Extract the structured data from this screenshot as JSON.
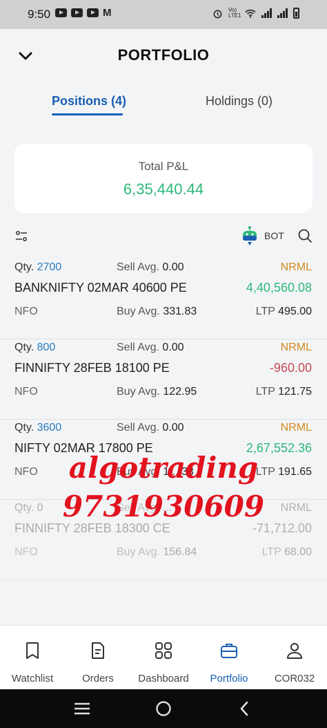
{
  "status_bar": {
    "time": "9:50",
    "network_label": "Vo) LTE1"
  },
  "header": {
    "title": "PORTFOLIO",
    "back_icon": "chevron-down-icon"
  },
  "tabs": [
    {
      "label": "Positions (4)",
      "active": true
    },
    {
      "label": "Holdings (0)",
      "active": false
    }
  ],
  "pnl": {
    "label": "Total P&L",
    "value": "6,35,440.44"
  },
  "toolbar": {
    "bot_label": "BOT"
  },
  "positions": [
    {
      "qty_label": "Qty.",
      "qty": "2700",
      "sell_label": "Sell Avg.",
      "sell_avg": "0.00",
      "product": "NRML",
      "symbol": "BANKNIFTY 02MAR 40600 PE",
      "pnl": "4,40,560.08",
      "pnl_sign": "positive",
      "exchange": "NFO",
      "buy_label": "Buy Avg.",
      "buy_avg": "331.83",
      "ltp_label": "LTP",
      "ltp": "495.00"
    },
    {
      "qty_label": "Qty.",
      "qty": "800",
      "sell_label": "Sell Avg.",
      "sell_avg": "0.00",
      "product": "NRML",
      "symbol": "FINNIFTY 28FEB 18100 PE",
      "pnl": "-960.00",
      "pnl_sign": "negative",
      "exchange": "NFO",
      "buy_label": "Buy Avg.",
      "buy_avg": "122.95",
      "ltp_label": "LTP",
      "ltp": "121.75"
    },
    {
      "qty_label": "Qty.",
      "qty": "3600",
      "sell_label": "Sell Avg.",
      "sell_avg": "0.00",
      "product": "NRML",
      "symbol": "NIFTY 02MAR 17800 PE",
      "pnl": "2,67,552.36",
      "pnl_sign": "positive",
      "exchange": "NFO",
      "buy_label": "Buy Avg.",
      "buy_avg": "1....33",
      "ltp_label": "LTP",
      "ltp": "191.65"
    },
    {
      "qty_label": "Qty.",
      "qty": "0",
      "sell_label": "Sell Avg.",
      "sell_avg": "...",
      "product": "NRML",
      "symbol": "FINNIFTY 28FEB 18300 CE",
      "pnl": "-71,712.00",
      "pnl_sign": "negative",
      "exchange": "NFO",
      "buy_label": "Buy Avg.",
      "buy_avg": "156.84",
      "ltp_label": "LTP",
      "ltp": "68.00"
    }
  ],
  "watermark": {
    "line1": "algotrading",
    "line2": "9731930609"
  },
  "bottom_nav": [
    {
      "label": "Watchlist",
      "icon": "bookmark-icon",
      "active": false
    },
    {
      "label": "Orders",
      "icon": "document-icon",
      "active": false
    },
    {
      "label": "Dashboard",
      "icon": "grid-icon",
      "active": false
    },
    {
      "label": "Portfolio",
      "icon": "briefcase-icon",
      "active": true
    },
    {
      "label": "COR032",
      "icon": "user-icon",
      "active": false
    }
  ],
  "colors": {
    "accent": "#1a5fb4",
    "profit": "#2eb87a",
    "loss": "#c44a5a",
    "product": "#d08a1c",
    "qty": "#2a7bbf",
    "watermark": "#e2131f"
  }
}
